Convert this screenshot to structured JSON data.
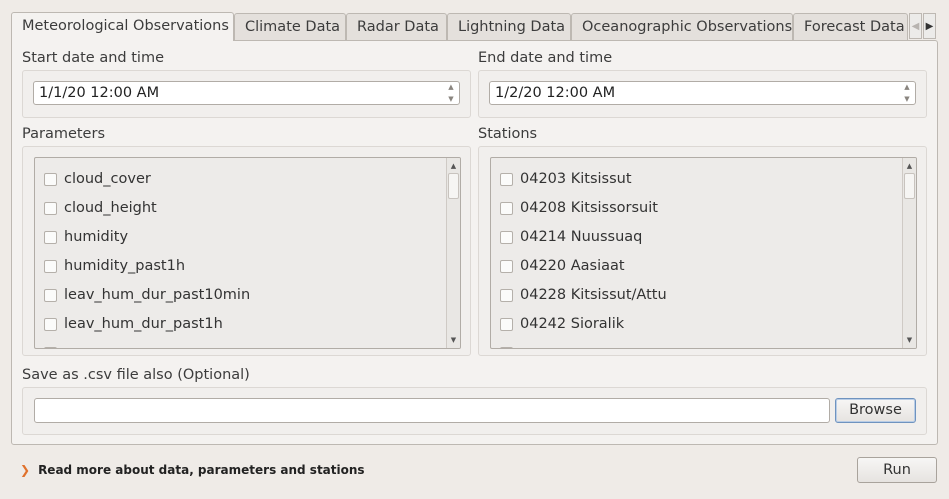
{
  "tabs": [
    {
      "label": "Meteorological Observations",
      "active": true
    },
    {
      "label": "Climate Data"
    },
    {
      "label": "Radar Data"
    },
    {
      "label": "Lightning Data"
    },
    {
      "label": "Oceanographic Observations"
    },
    {
      "label": "Forecast Data"
    }
  ],
  "start": {
    "label": "Start date and time",
    "value": "1/1/20 12:00 AM"
  },
  "end": {
    "label": "End date and time",
    "value": "1/2/20 12:00 AM"
  },
  "parameters": {
    "label": "Parameters",
    "items": [
      "cloud_cover",
      "cloud_height",
      "humidity",
      "humidity_past1h",
      "leav_hum_dur_past10min",
      "leav_hum_dur_past1h"
    ]
  },
  "stations": {
    "label": "Stations",
    "items": [
      "04203 Kitsissut",
      "04208 Kitsissorsuit",
      "04214 Nuussuaq",
      "04220 Aasiaat",
      "04228 Kitsissut/Attu",
      "04242 Sioralik"
    ]
  },
  "save": {
    "label": "Save as .csv file also (Optional)",
    "value": "",
    "browse_label": "Browse"
  },
  "footer": {
    "read_more": "Read more about data, parameters and stations",
    "run_label": "Run"
  },
  "icons": {
    "tab_left": "chevron-left-icon",
    "tab_right": "chevron-right-icon",
    "spin_up": "spin-up-icon",
    "spin_down": "spin-down-icon",
    "read_more": "expand-arrow-icon"
  },
  "colors": {
    "accent": "#e0712c",
    "focus": "#6f93bf"
  }
}
